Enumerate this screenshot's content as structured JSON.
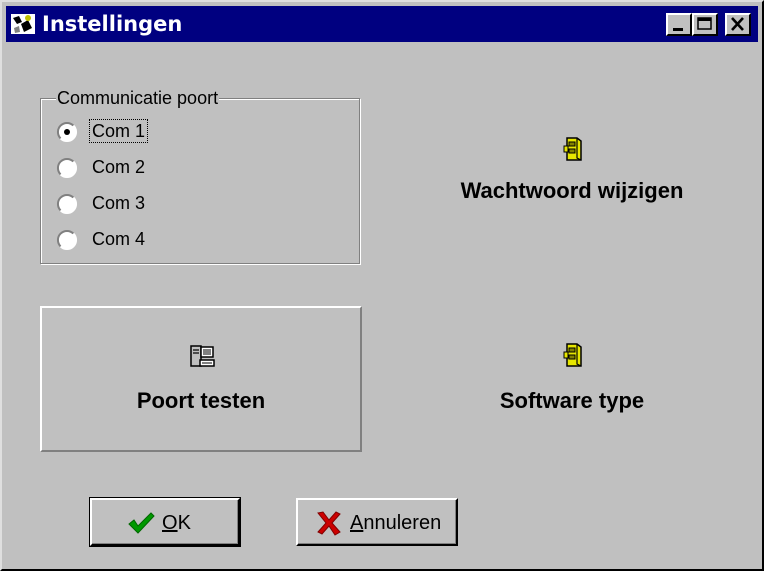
{
  "window": {
    "title": "Instellingen",
    "controls": [
      "minimize-icon",
      "maximize-icon",
      "close-icon"
    ]
  },
  "com_group": {
    "legend": "Communicatie poort",
    "options": [
      {
        "label": "Com 1",
        "selected": true
      },
      {
        "label": "Com 2",
        "selected": false
      },
      {
        "label": "Com 3",
        "selected": false
      },
      {
        "label": "Com 4",
        "selected": false
      }
    ]
  },
  "actions": {
    "password_change": {
      "label": "Wachtwoord wijzigen",
      "icon": "cabinet-icon"
    },
    "port_test": {
      "label": "Poort testen",
      "icon": "computer-icon"
    },
    "software_type": {
      "label": "Software type",
      "icon": "cabinet-icon"
    }
  },
  "buttons": {
    "ok": {
      "label_accel": "O",
      "label_rest": "K",
      "icon": "checkmark-icon"
    },
    "cancel": {
      "label_accel": "A",
      "label_rest": "nnuleren",
      "icon": "x-icon"
    }
  },
  "colors": {
    "face": "#c0c0c0",
    "titlebar": "#000080",
    "ok_check": "#009900",
    "cancel_x": "#cc0000",
    "cabinet": "#e6e600"
  }
}
